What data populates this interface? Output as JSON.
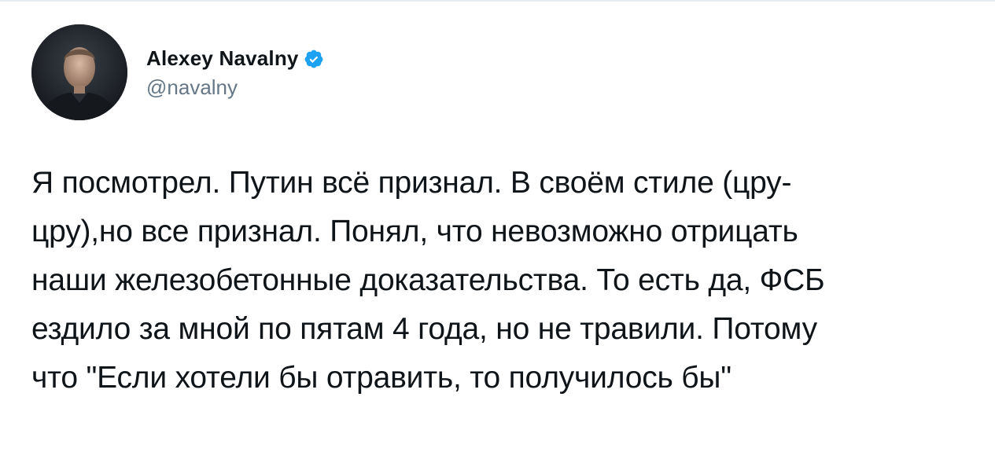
{
  "tweet": {
    "author": {
      "display_name": "Alexey Navalny",
      "handle": "@navalny",
      "verified": true
    },
    "text_lines": [
      "Я посмотрел. Путин всё признал. В своём стиле (цру-",
      "цру),но все признал. Понял, что невозможно отрицать",
      "наши железобетонные доказательства. То есть да, ФСБ",
      "ездило за мной по пятам 4 года, но не травили. Потому",
      "что \"Если хотели бы отравить, то получилось бы\""
    ]
  },
  "colors": {
    "text": "#0f1419",
    "secondary_text": "#657786",
    "verified_badge": "#1da1f2",
    "divider": "#e6ecf0"
  }
}
